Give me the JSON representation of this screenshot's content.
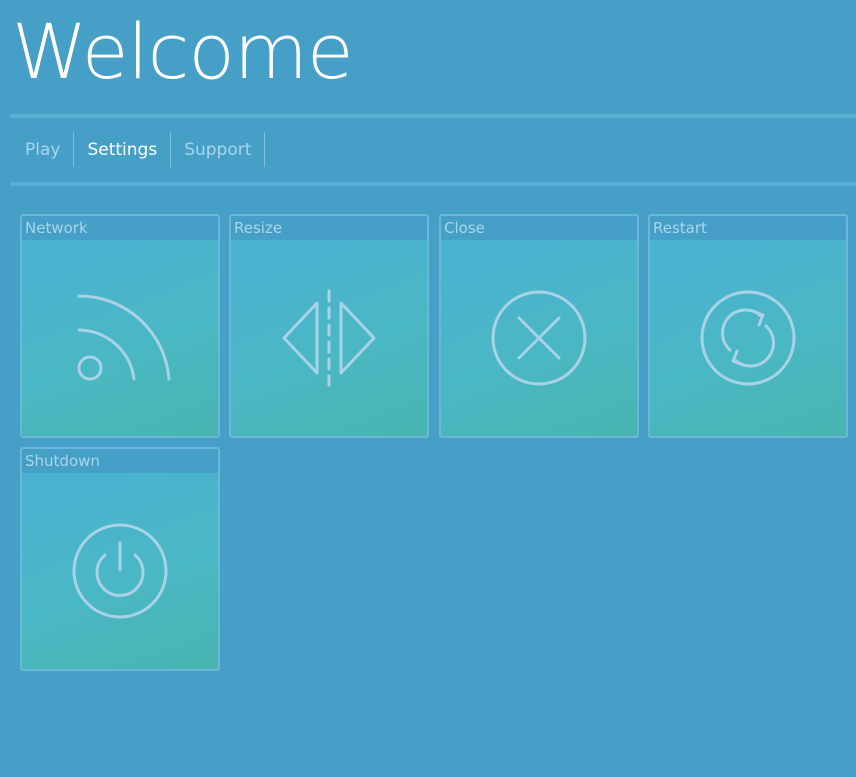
{
  "header": {
    "title": "Welcome"
  },
  "nav": {
    "items": [
      {
        "label": "Play",
        "active": false
      },
      {
        "label": "Settings",
        "active": true
      },
      {
        "label": "Support",
        "active": false
      }
    ]
  },
  "tiles": [
    {
      "label": "Network",
      "icon": "wifi-signal-icon"
    },
    {
      "label": "Resize",
      "icon": "resize-icon"
    },
    {
      "label": "Close",
      "icon": "close-circle-icon"
    },
    {
      "label": "Restart",
      "icon": "restart-icon"
    },
    {
      "label": "Shutdown",
      "icon": "power-icon"
    }
  ],
  "colors": {
    "background": "#469fc6",
    "tile_gradient_start": "#4bb1d6",
    "tile_gradient_end": "#48b5b0",
    "icon_stroke": "#a8d3e6",
    "muted_text": "#a8d6ea"
  }
}
